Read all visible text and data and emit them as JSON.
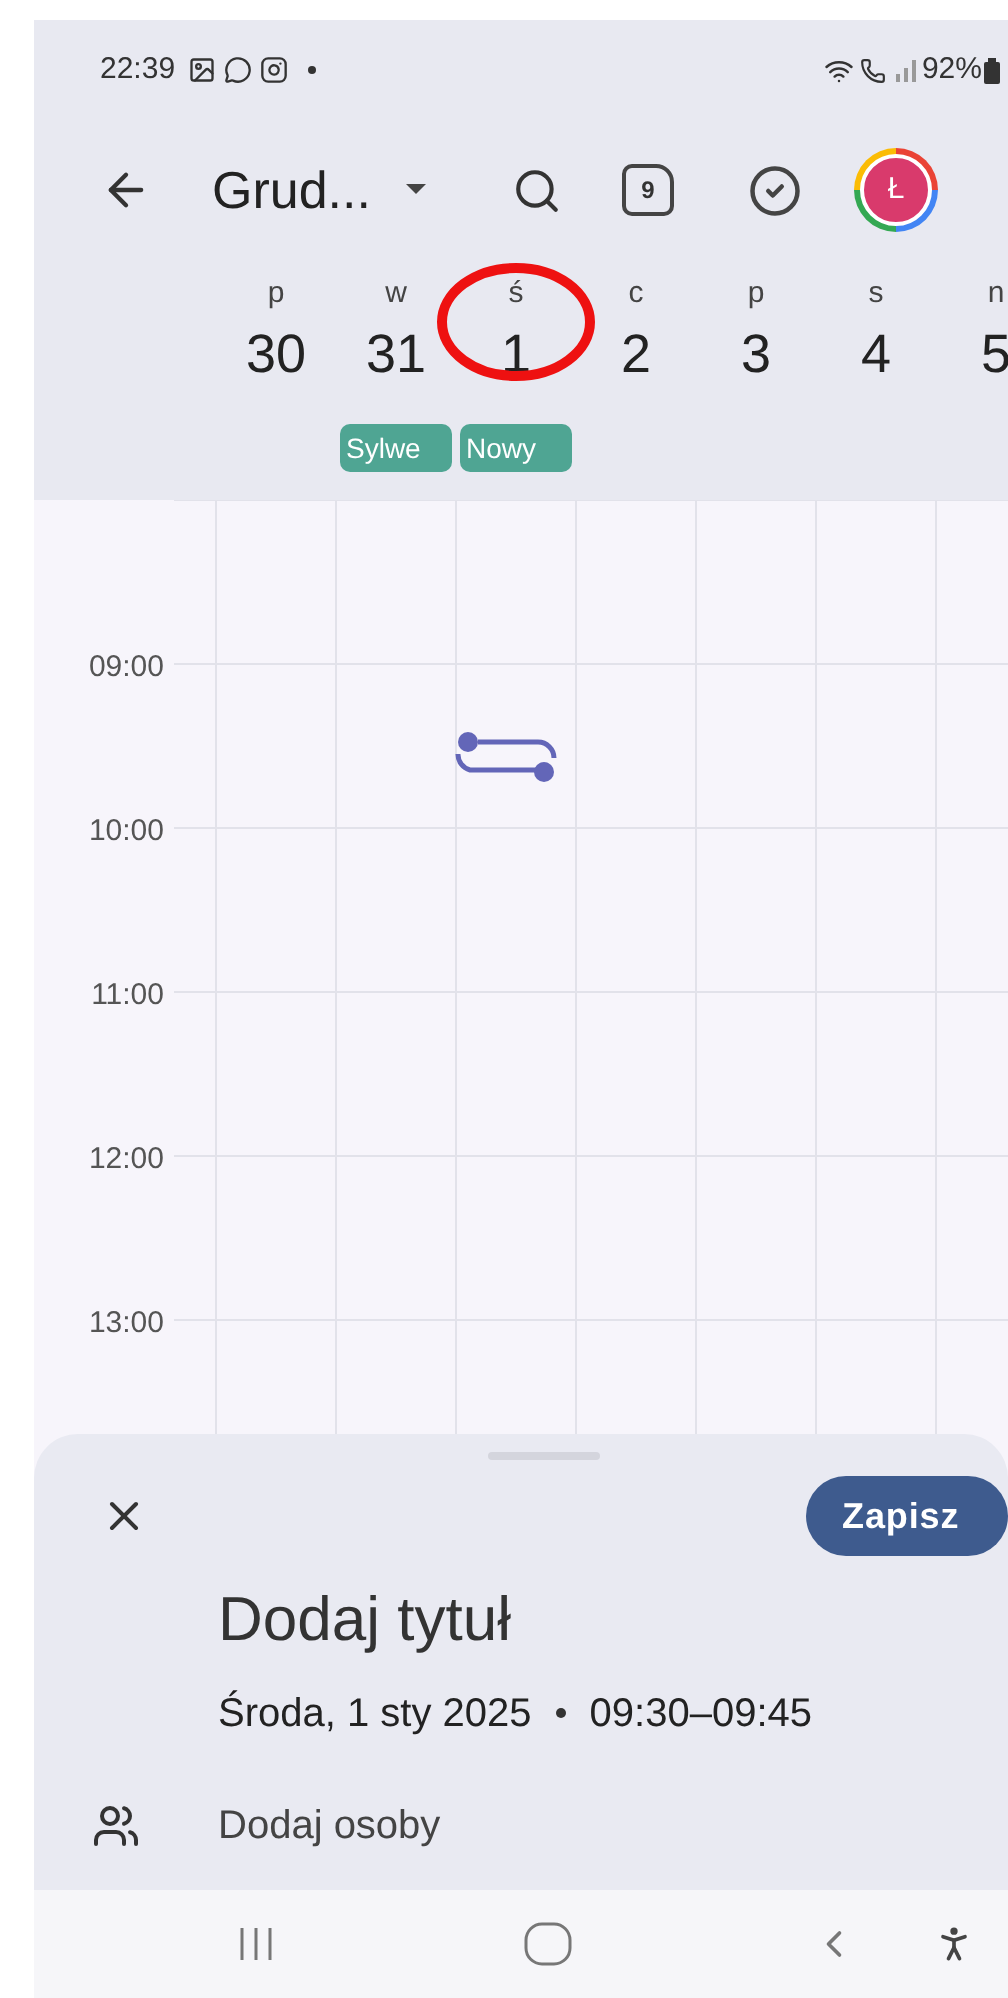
{
  "status_bar": {
    "time": "22:39",
    "battery": "92%"
  },
  "toolbar": {
    "title": "Grud...",
    "today_badge": "9",
    "avatar": "Ł"
  },
  "days": [
    {
      "letter": "p",
      "number": "30",
      "circled": false
    },
    {
      "letter": "w",
      "number": "31",
      "circled": false,
      "all_day_event": {
        "label": "Sylwe",
        "color": "#4fa593"
      }
    },
    {
      "letter": "ś",
      "number": "1",
      "circled": true,
      "all_day_event": {
        "label": "Nowy",
        "color": "#4fa593"
      }
    },
    {
      "letter": "c",
      "number": "2",
      "circled": false
    },
    {
      "letter": "p",
      "number": "3",
      "circled": false
    },
    {
      "letter": "s",
      "number": "4",
      "circled": false
    },
    {
      "letter": "n",
      "number": "5",
      "circled": false
    }
  ],
  "hours": [
    "09:00",
    "10:00",
    "11:00",
    "12:00",
    "13:00"
  ],
  "sheet": {
    "save": "Zapisz",
    "title_placeholder": "Dodaj tytuł",
    "date": "Środa, 1 sty 2025",
    "time": "09:30–09:45",
    "people": "Dodaj osoby"
  }
}
